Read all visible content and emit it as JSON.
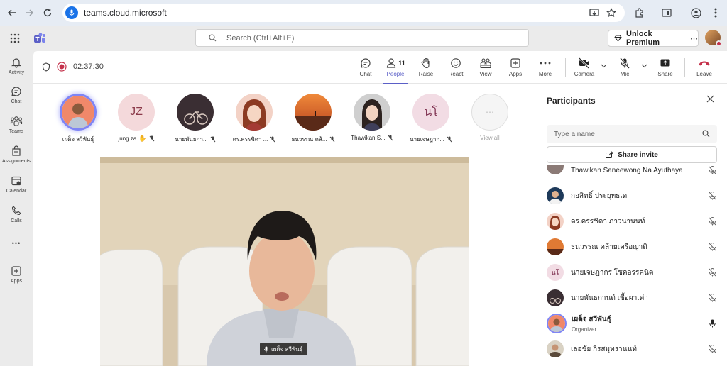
{
  "browser": {
    "url": "teams.cloud.microsoft"
  },
  "header": {
    "search_placeholder": "Search (Ctrl+Alt+E)",
    "unlock_label": "Unlock Premium",
    "more": "⋯"
  },
  "rail": [
    {
      "label": "Activity",
      "icon": "bell-icon"
    },
    {
      "label": "Chat",
      "icon": "chat-icon"
    },
    {
      "label": "Teams",
      "icon": "teams-icon"
    },
    {
      "label": "Assignments",
      "icon": "assignments-icon"
    },
    {
      "label": "Calendar",
      "icon": "calendar-icon"
    },
    {
      "label": "Calls",
      "icon": "phone-icon"
    },
    {
      "label": "•••",
      "icon": "more-icon"
    },
    {
      "label": "Apps",
      "icon": "apps-icon"
    }
  ],
  "meeting": {
    "timer": "02:37:30",
    "people_count": "11",
    "controls": {
      "chat": "Chat",
      "people": "People",
      "raise": "Raise",
      "react": "React",
      "view": "View",
      "apps": "Apps",
      "more": "More",
      "camera": "Camera",
      "mic": "Mic",
      "share": "Share",
      "leave": "Leave"
    },
    "gallery": [
      {
        "name": "เผด็จ สวีพันธุ์"
      },
      {
        "name": "jung za",
        "initials": "JZ"
      },
      {
        "name": "นายพันธกา..."
      },
      {
        "name": "ดร.ครรชิดา ..."
      },
      {
        "name": "ธนวรรณ คล้..."
      },
      {
        "name": "Thawikan S..."
      },
      {
        "name": "นายเจษฎาก...",
        "initials": "นโ"
      },
      {
        "name": "View all"
      }
    ],
    "speaker_chip": "เผด็จ สวีพันธุ์"
  },
  "participants": {
    "title": "Participants",
    "search_placeholder": "Type a name",
    "share_invite": "Share invite",
    "list": [
      {
        "name": "Thawikan Saneewong Na Ayuthaya"
      },
      {
        "name": "กอสิทธิ์ ประยุทธเด"
      },
      {
        "name": "ดร.ครรชิดา ภาวนานนท์"
      },
      {
        "name": "ธนวรรณ คล้ายเครือญาติ"
      },
      {
        "name": "นายเจษฎากร โชคอรรคนิต",
        "initials": "นโ"
      },
      {
        "name": "นายพันธกานต์ เชื้อผาเต่า"
      },
      {
        "name": "เผด็จ สวีพันธุ์",
        "role": "Organizer"
      },
      {
        "name": "เลอชัย กิรสมุทรานนท์"
      }
    ]
  },
  "colors": {
    "accent": "#5b5fc7",
    "leave": "#c4314b",
    "record": "#c4314b"
  }
}
